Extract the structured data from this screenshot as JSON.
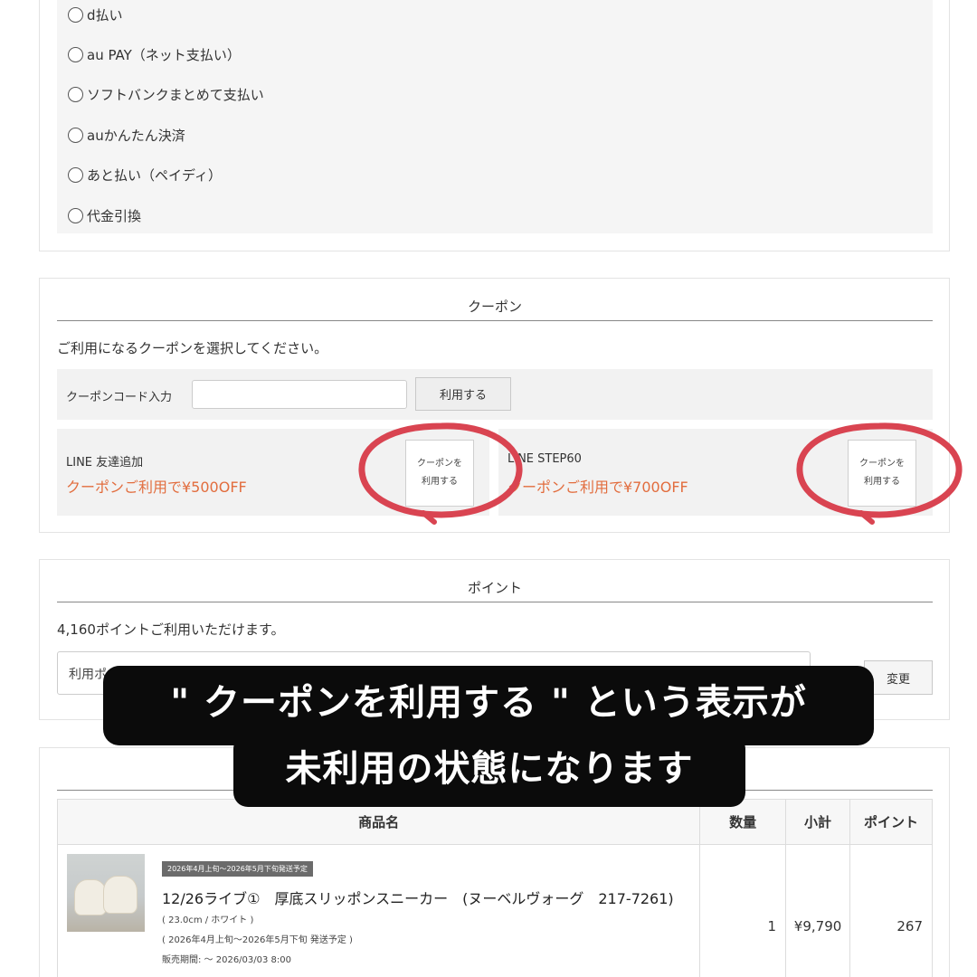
{
  "payment": {
    "options": [
      "d払い",
      "au PAY（ネット支払い）",
      "ソフトバンクまとめて支払い",
      "auかんたん決済",
      "あと払い（ペイディ）",
      "代金引換"
    ]
  },
  "coupon": {
    "title": "クーポン",
    "instruction": "ご利用になるクーポンを選択してください。",
    "code_label": "クーポンコード入力",
    "code_value": "",
    "apply_label": "利用する",
    "items": [
      {
        "title": "LINE 友達追加",
        "offer": "クーポンご利用で¥500OFF",
        "button_line1": "クーポンを",
        "button_line2": "利用する"
      },
      {
        "title": "LINE STEP60",
        "offer": "クーポンご利用で¥700OFF",
        "button_line1": "クーポンを",
        "button_line2": "利用する"
      }
    ],
    "highlight_color": "#d94451"
  },
  "points": {
    "title": "ポイント",
    "available": "4,160ポイントご利用いただけます。",
    "input_label": "利用ポ",
    "change_label": "変更"
  },
  "products": {
    "headers": [
      "商品名",
      "数量",
      "小計",
      "ポイント"
    ],
    "items": [
      {
        "badge": "2026年4月上旬〜2026年5月下旬発送予定",
        "name": "12/26ライブ①　厚底スリッポンスニーカー　(ヌーベルヴォーグ　217-7261)",
        "variant": "( 23.0cm / ホワイト )",
        "shipping": "( 2026年4月上旬〜2026年5月下旬 発送予定 )",
        "sale_period": "販売期間: 〜 2026/03/03 8:00",
        "quantity": "1",
        "subtotal": "¥9,790",
        "points": "267"
      }
    ]
  },
  "overlay": {
    "line1": "\" クーポンを利用する \" という表示が",
    "line2": "未利用の状態になります"
  }
}
